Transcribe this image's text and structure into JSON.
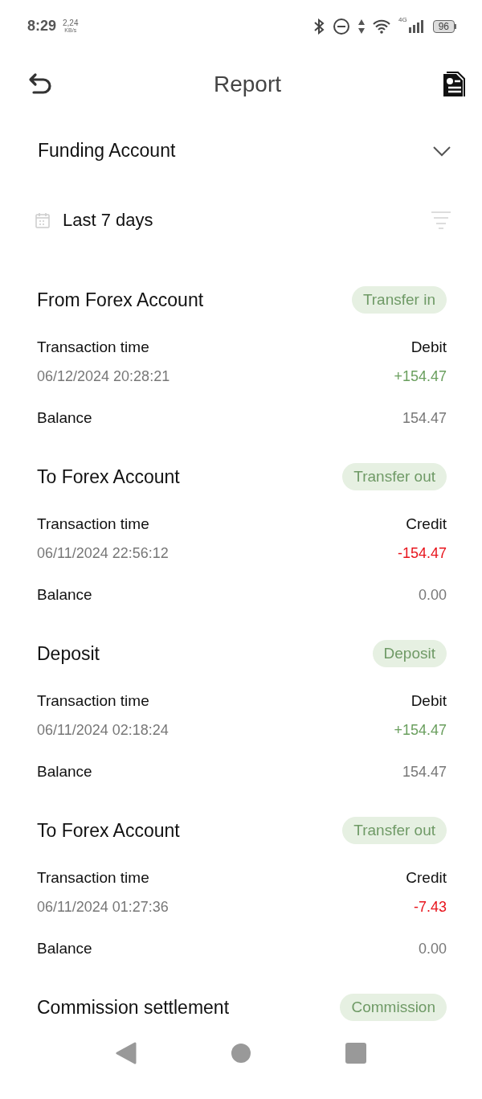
{
  "status_bar": {
    "time": "8:29",
    "speed": "2,24",
    "speed_unit": "KB/s",
    "network": "4G",
    "battery": "96"
  },
  "header": {
    "title": "Report"
  },
  "account": {
    "label": "Funding Account"
  },
  "period": {
    "label": "Last 7 days"
  },
  "transactions": [
    {
      "title": "From Forex Account",
      "tag": "Transfer in",
      "time_label": "Transaction time",
      "side_label": "Debit",
      "time": "06/12/2024 20:28:21",
      "amount": "+154.47",
      "kind": "debit",
      "balance_label": "Balance",
      "balance": "154.47"
    },
    {
      "title": "To Forex Account",
      "tag": "Transfer out",
      "time_label": "Transaction time",
      "side_label": "Credit",
      "time": "06/11/2024 22:56:12",
      "amount": "-154.47",
      "kind": "credit",
      "balance_label": "Balance",
      "balance": "0.00"
    },
    {
      "title": "Deposit",
      "tag": "Deposit",
      "time_label": "Transaction time",
      "side_label": "Debit",
      "time": "06/11/2024 02:18:24",
      "amount": "+154.47",
      "kind": "debit",
      "balance_label": "Balance",
      "balance": "154.47"
    },
    {
      "title": "To Forex Account",
      "tag": "Transfer out",
      "time_label": "Transaction time",
      "side_label": "Credit",
      "time": "06/11/2024 01:27:36",
      "amount": "-7.43",
      "kind": "credit",
      "balance_label": "Balance",
      "balance": "0.00"
    },
    {
      "title": "Commission settlement",
      "tag": "Commission"
    }
  ]
}
